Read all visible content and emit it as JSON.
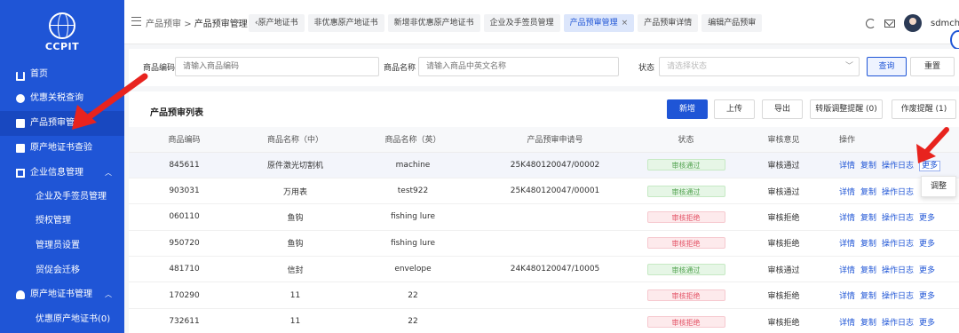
{
  "logo": {
    "text": "CCPIT"
  },
  "sidebar": {
    "items": [
      {
        "label": "首页",
        "icon": "home-icon"
      },
      {
        "label": "优惠关税查询",
        "icon": "search-icon"
      },
      {
        "label": "产品预审管理",
        "icon": "box-icon"
      },
      {
        "label": "原产地证书查验",
        "icon": "certificate-icon"
      },
      {
        "label": "企业信息管理",
        "icon": "building-icon"
      },
      {
        "label": "企业及手签员管理"
      },
      {
        "label": "授权管理"
      },
      {
        "label": "管理员设置"
      },
      {
        "label": "贸促会迁移"
      },
      {
        "label": "原产地证书管理",
        "icon": "user-icon"
      },
      {
        "label": "优惠原产地证书(0)"
      }
    ]
  },
  "header": {
    "breadcrumb": {
      "parent": "产品预审",
      "separator": ">",
      "current": "产品预审管理"
    },
    "tabs": [
      {
        "label": "‹原产地证书"
      },
      {
        "label": "非优惠原产地证书"
      },
      {
        "label": "新增非优惠原产地证书"
      },
      {
        "label": "企业及手签员管理"
      },
      {
        "label": "产品预审管理",
        "close": "×"
      },
      {
        "label": "产品预审详情"
      },
      {
        "label": "编辑产品预审"
      }
    ],
    "tab_prev": "‹",
    "tab_next": "›",
    "username": "sdmch1"
  },
  "search": {
    "code_label": "商品编码",
    "code_placeholder": "请输入商品编码",
    "name_label": "商品名称",
    "name_placeholder": "请输入商品中英文名称",
    "status_label": "状态",
    "status_placeholder": "请选择状态",
    "query_button": "查询",
    "reset_button": "重置"
  },
  "list": {
    "title": "产品预审列表",
    "buttons": {
      "add": "新增",
      "upload": "上传",
      "export": "导出",
      "transfer": "转版调整提醒 (0)",
      "void": "作废提醒 (1)"
    },
    "columns": [
      "商品编码",
      "商品名称（中）",
      "商品名称（英）",
      "产品预审申请号",
      "状态",
      "审核意见",
      "操作"
    ],
    "rows": [
      {
        "code": "845611",
        "name_cn": "原件激光切割机",
        "name_en": "machine",
        "apply_no": "25K480120047/00002",
        "status": "审核通过",
        "status_type": "pass",
        "opinion": "审核通过"
      },
      {
        "code": "903031",
        "name_cn": "万用表",
        "name_en": "test922",
        "apply_no": "25K480120047/00001",
        "status": "审核通过",
        "status_type": "pass",
        "opinion": "审核通过"
      },
      {
        "code": "060110",
        "name_cn": "鱼钩",
        "name_en": "fishing lure",
        "apply_no": "",
        "status": "审核拒绝",
        "status_type": "reject",
        "opinion": "审核拒绝"
      },
      {
        "code": "950720",
        "name_cn": "鱼钩",
        "name_en": "fishing lure",
        "apply_no": "",
        "status": "审核拒绝",
        "status_type": "reject",
        "opinion": "审核拒绝"
      },
      {
        "code": "481710",
        "name_cn": "信封",
        "name_en": "envelope",
        "apply_no": "24K480120047/10005",
        "status": "审核通过",
        "status_type": "pass",
        "opinion": "审核通过"
      },
      {
        "code": "170290",
        "name_cn": "11",
        "name_en": "22",
        "apply_no": "",
        "status": "审核拒绝",
        "status_type": "reject",
        "opinion": "审核拒绝"
      },
      {
        "code": "732611",
        "name_cn": "11",
        "name_en": "22",
        "apply_no": "",
        "status": "审核拒绝",
        "status_type": "reject",
        "opinion": "审核拒绝"
      }
    ],
    "ops": {
      "detail": "详情",
      "copy": "复制",
      "log": "操作日志",
      "more": "更多"
    },
    "dropdown_item": "调整"
  },
  "colors": {
    "primary": "#1f55d6",
    "pass": "#52a350",
    "reject": "#e45467",
    "annotation_arrow": "#e8231e"
  }
}
